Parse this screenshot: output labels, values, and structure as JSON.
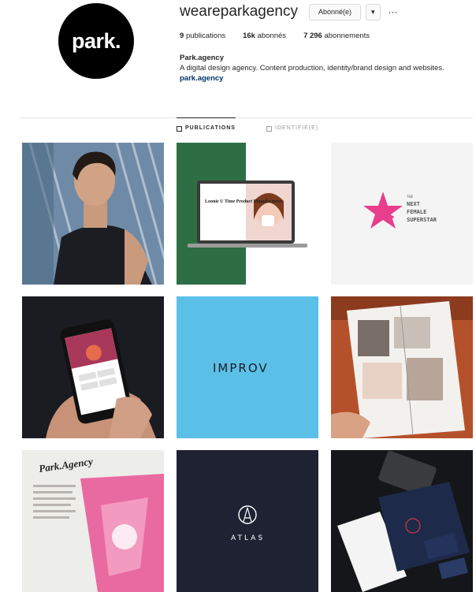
{
  "profile": {
    "avatar_text": "park.",
    "username": "weareparkagency",
    "follow_button": "Abonné(e)",
    "dropdown_icon": "caret-down-icon",
    "more_icon": "ellipsis-icon",
    "stats": [
      {
        "value": "9",
        "label": "publications"
      },
      {
        "value": "16k",
        "label": "abonnés"
      },
      {
        "value": "7 296",
        "label": "abonnements"
      }
    ],
    "bio": {
      "name": "Park.agency",
      "text": "A digital design agency. Content production, identity/brand design and websites.",
      "link": "park.agency"
    }
  },
  "tabs": [
    {
      "label": "PUBLICATIONS",
      "icon": "grid-icon",
      "active": true
    },
    {
      "label": "IDENTIFIÉ(E)",
      "icon": "tag-icon",
      "active": false
    }
  ],
  "posts": [
    {
      "id": "post-portrait"
    },
    {
      "id": "post-laptop",
      "laptop_text": "Loonie U Time Product Manufacturer"
    },
    {
      "id": "post-superstar",
      "small": "THE",
      "line1": "NEXT",
      "line2": "FEMALE",
      "line3": "SUPERSTAR",
      "accent": "#e83e8c"
    },
    {
      "id": "post-phone"
    },
    {
      "id": "post-improv",
      "logo": "IMPROV",
      "bg": "#5bc0e8"
    },
    {
      "id": "post-magazine"
    },
    {
      "id": "post-article",
      "title": "Park.Agency"
    },
    {
      "id": "post-atlas",
      "logo": "ATLAS",
      "bg": "#1f2233"
    },
    {
      "id": "post-stationery"
    }
  ]
}
